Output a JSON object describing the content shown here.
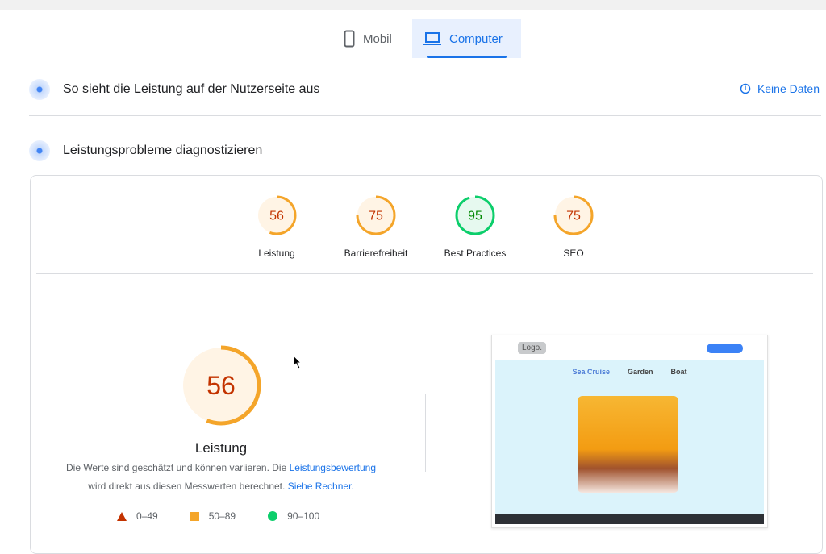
{
  "tabs": [
    {
      "label": "Mobil",
      "icon": "phone-icon"
    },
    {
      "label": "Computer",
      "icon": "laptop-icon",
      "active": true
    }
  ],
  "field_section": {
    "title": "So sieht die Leistung auf der Nutzerseite aus",
    "status": "Keine Daten"
  },
  "lab_section": {
    "title": "Leistungsprobleme diagnostizieren"
  },
  "scores": [
    {
      "label": "Leistung",
      "value": 56,
      "color": "#f4a52a"
    },
    {
      "label": "Barrierefreiheit",
      "value": 75,
      "color": "#f4a52a"
    },
    {
      "label": "Best Practices",
      "value": 95,
      "color": "#0cce6b"
    },
    {
      "label": "SEO",
      "value": 75,
      "color": "#f4a52a"
    }
  ],
  "main_score": {
    "label": "Leistung",
    "value": 56
  },
  "description": {
    "text1": "Die Werte sind geschätzt und können variieren. Die ",
    "link1": "Leistungsbewertung",
    "text2": "wird direkt aus diesen Messwerten berechnet. ",
    "link2": "Siehe Rechner."
  },
  "legend": [
    {
      "range": "0–49",
      "color": "#c33300"
    },
    {
      "range": "50–89",
      "color": "#f4a52a"
    },
    {
      "range": "90–100",
      "color": "#0cce6b"
    }
  ],
  "preview": {
    "logo": "Logo.",
    "nav": [
      "Sea Cruise",
      "Garden",
      "Boat"
    ]
  }
}
